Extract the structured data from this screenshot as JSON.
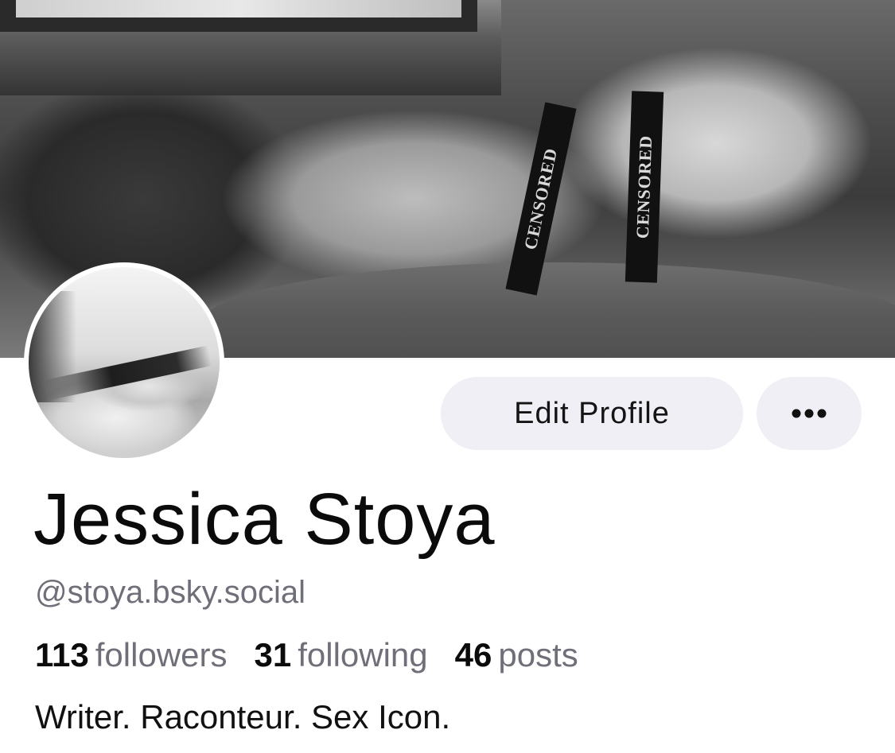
{
  "banner": {
    "band_text_1": "CENSORED",
    "band_text_2": "CENSORED"
  },
  "profile": {
    "display_name": "Jessica Stoya",
    "handle": "@stoya.bsky.social",
    "bio": "Writer. Raconteur. Sex Icon."
  },
  "actions": {
    "edit_label": "Edit Profile",
    "more_icon": "ellipsis-icon"
  },
  "stats": {
    "followers_count": "113",
    "followers_label": "followers",
    "following_count": "31",
    "following_label": "following",
    "posts_count": "46",
    "posts_label": "posts"
  },
  "colors": {
    "button_bg": "#efeff5",
    "secondary_text": "#6f6f79",
    "primary_text": "#0b0b0b"
  }
}
